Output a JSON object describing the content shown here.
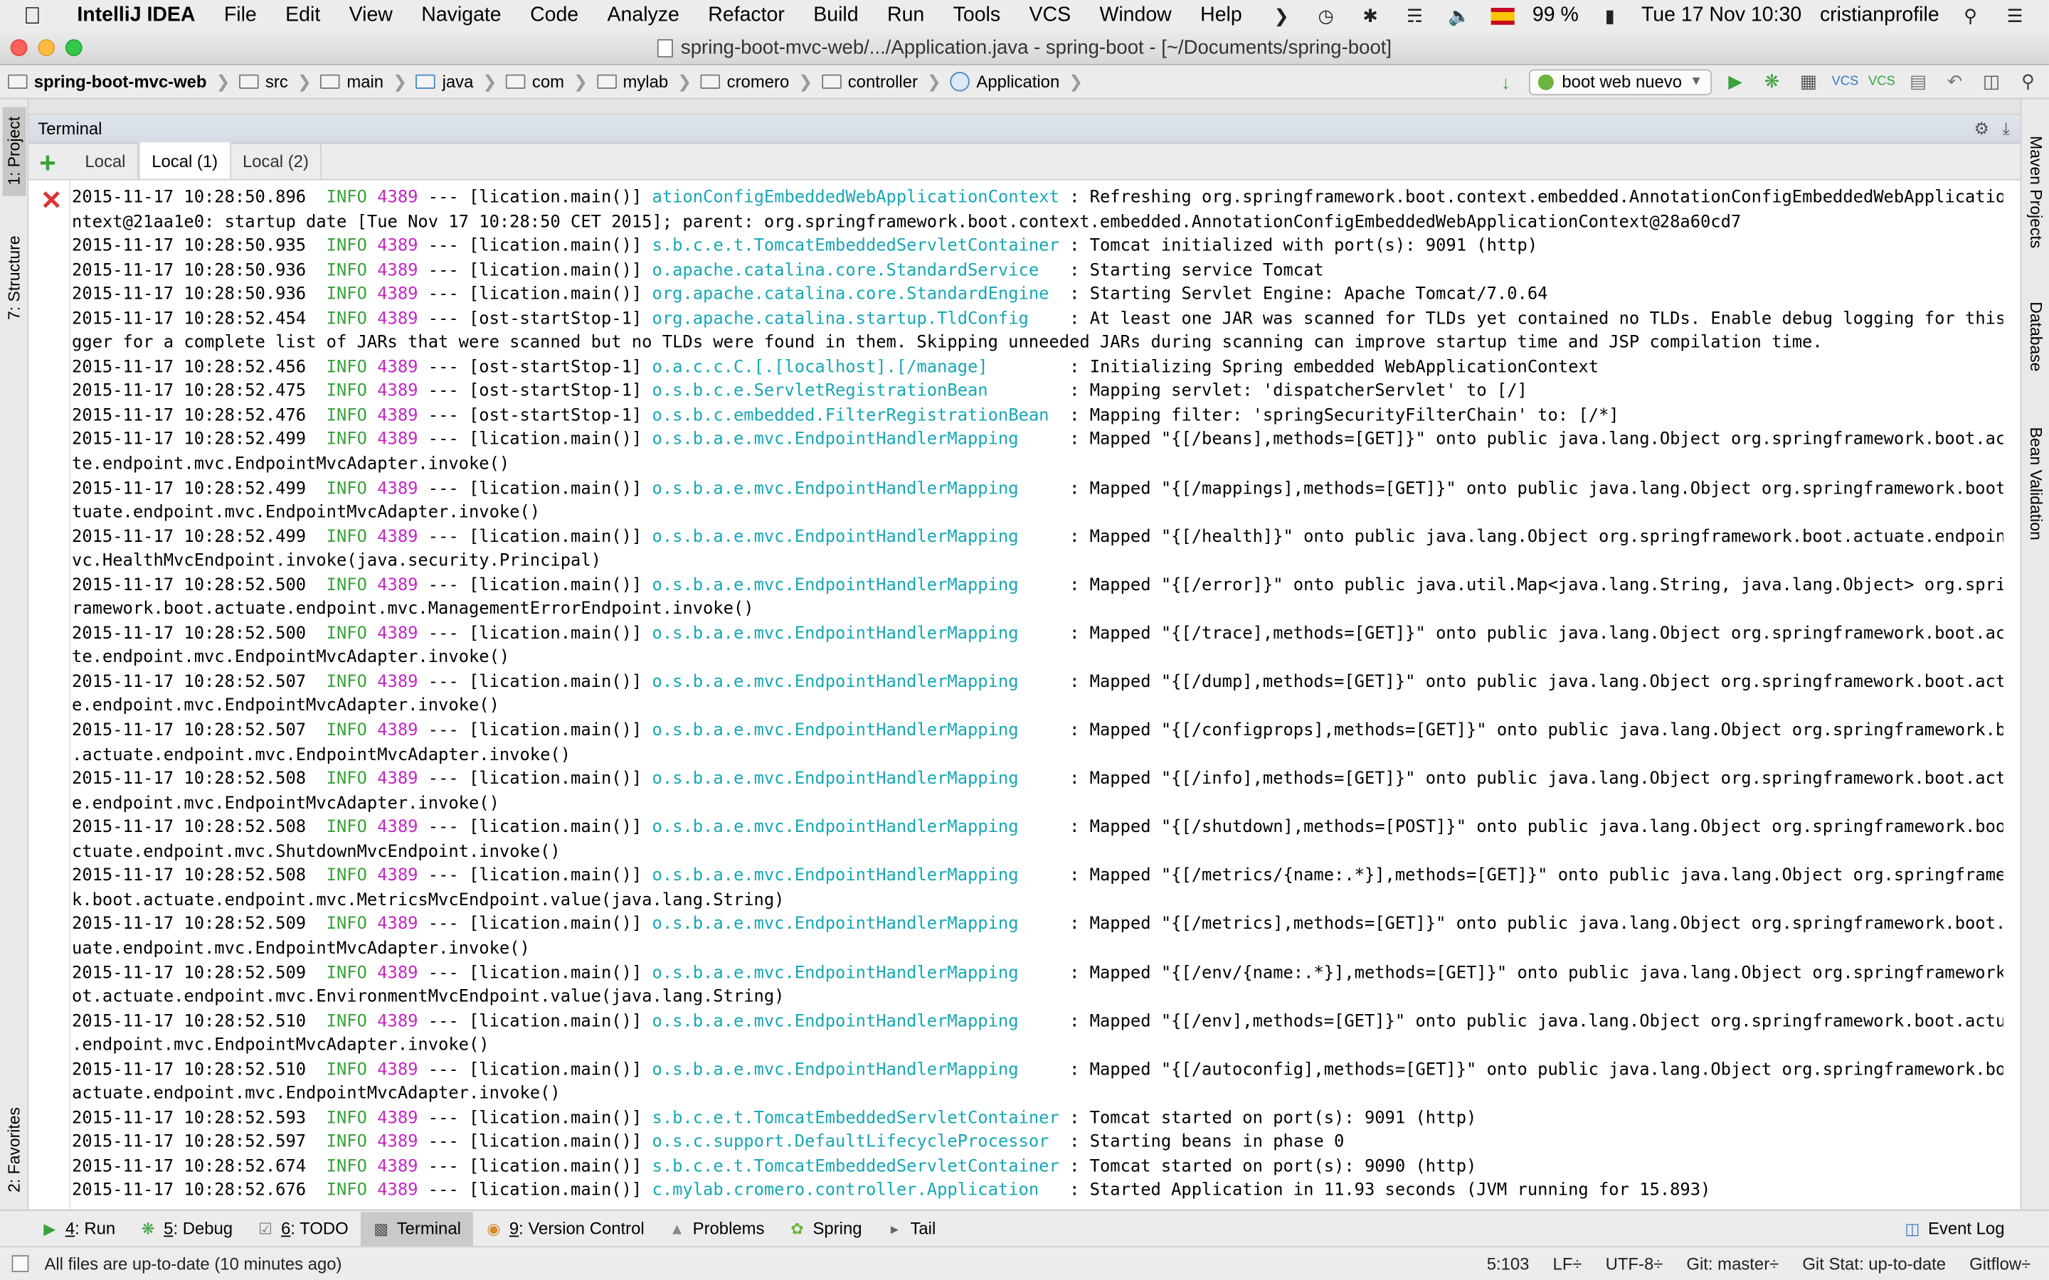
{
  "menubar": {
    "app_name": "IntelliJ IDEA",
    "items": [
      "File",
      "Edit",
      "View",
      "Navigate",
      "Code",
      "Analyze",
      "Refactor",
      "Build",
      "Run",
      "Tools",
      "VCS",
      "Window",
      "Help"
    ],
    "battery": "99 %",
    "datetime": "Tue 17 Nov  10:30",
    "user": "cristianprofile"
  },
  "window": {
    "title": "spring-boot-mvc-web/.../Application.java - spring-boot - [~/Documents/spring-boot]"
  },
  "navbar": {
    "crumbs": [
      "spring-boot-mvc-web",
      "src",
      "main",
      "java",
      "com",
      "mylab",
      "cromero",
      "controller",
      "Application"
    ],
    "run_config": "boot web nuevo"
  },
  "left_stripe": {
    "project": "1: Project",
    "structure": "7: Structure",
    "favorites": "2: Favorites"
  },
  "right_stripe": {
    "maven": "Maven Projects",
    "database": "Database",
    "bean": "Bean Validation"
  },
  "terminal": {
    "title": "Terminal",
    "tabs": [
      "Local",
      "Local (1)",
      "Local (2)"
    ],
    "selected_tab": "Local (1)",
    "lines": [
      {
        "ts": "2015-11-17 10:28:50.896",
        "level": "INFO",
        "pid": "4389",
        "thread": " --- [lication.main()] ",
        "cls": "ationConfigEmbeddedWebApplicationContext",
        "pad": " ",
        "msg": ": Refreshing org.springframework.boot.context.embedded.AnnotationConfigEmbeddedWebApplicationCo"
      },
      {
        "cont": "ntext@21aa1e0: startup date [Tue Nov 17 10:28:50 CET 2015]; parent: org.springframework.boot.context.embedded.AnnotationConfigEmbeddedWebApplicationContext@28a60cd7"
      },
      {
        "ts": "2015-11-17 10:28:50.935",
        "level": "INFO",
        "pid": "4389",
        "thread": " --- [lication.main()] ",
        "cls": "s.b.c.e.t.TomcatEmbeddedServletContainer",
        "pad": " ",
        "msg": ": Tomcat initialized with port(s): 9091 (http)"
      },
      {
        "ts": "2015-11-17 10:28:50.936",
        "level": "INFO",
        "pid": "4389",
        "thread": " --- [lication.main()] ",
        "cls": "o.apache.catalina.core.StandardService",
        "pad": "   ",
        "msg": ": Starting service Tomcat"
      },
      {
        "ts": "2015-11-17 10:28:50.936",
        "level": "INFO",
        "pid": "4389",
        "thread": " --- [lication.main()] ",
        "cls": "org.apache.catalina.core.StandardEngine",
        "pad": "  ",
        "msg": ": Starting Servlet Engine: Apache Tomcat/7.0.64"
      },
      {
        "ts": "2015-11-17 10:28:52.454",
        "level": "INFO",
        "pid": "4389",
        "thread": " --- [ost-startStop-1] ",
        "cls": "org.apache.catalina.startup.TldConfig",
        "pad": "    ",
        "msg": ": At least one JAR was scanned for TLDs yet contained no TLDs. Enable debug logging for this lo"
      },
      {
        "cont": "gger for a complete list of JARs that were scanned but no TLDs were found in them. Skipping unneeded JARs during scanning can improve startup time and JSP compilation time."
      },
      {
        "ts": "2015-11-17 10:28:52.456",
        "level": "INFO",
        "pid": "4389",
        "thread": " --- [ost-startStop-1] ",
        "cls": "o.a.c.c.C.[.[localhost].[/manage]",
        "pad": "        ",
        "msg": ": Initializing Spring embedded WebApplicationContext"
      },
      {
        "ts": "2015-11-17 10:28:52.475",
        "level": "INFO",
        "pid": "4389",
        "thread": " --- [ost-startStop-1] ",
        "cls": "o.s.b.c.e.ServletRegistrationBean",
        "pad": "        ",
        "msg": ": Mapping servlet: 'dispatcherServlet' to [/]"
      },
      {
        "ts": "2015-11-17 10:28:52.476",
        "level": "INFO",
        "pid": "4389",
        "thread": " --- [ost-startStop-1] ",
        "cls": "o.s.b.c.embedded.FilterRegistrationBean",
        "pad": "  ",
        "msg": ": Mapping filter: 'springSecurityFilterChain' to: [/*]"
      },
      {
        "ts": "2015-11-17 10:28:52.499",
        "level": "INFO",
        "pid": "4389",
        "thread": " --- [lication.main()] ",
        "cls": "o.s.b.a.e.mvc.EndpointHandlerMapping",
        "pad": "     ",
        "msg": ": Mapped \"{[/beans],methods=[GET]}\" onto public java.lang.Object org.springframework.boot.actua"
      },
      {
        "cont": "te.endpoint.mvc.EndpointMvcAdapter.invoke()"
      },
      {
        "ts": "2015-11-17 10:28:52.499",
        "level": "INFO",
        "pid": "4389",
        "thread": " --- [lication.main()] ",
        "cls": "o.s.b.a.e.mvc.EndpointHandlerMapping",
        "pad": "     ",
        "msg": ": Mapped \"{[/mappings],methods=[GET]}\" onto public java.lang.Object org.springframework.boot.ac"
      },
      {
        "cont": "tuate.endpoint.mvc.EndpointMvcAdapter.invoke()"
      },
      {
        "ts": "2015-11-17 10:28:52.499",
        "level": "INFO",
        "pid": "4389",
        "thread": " --- [lication.main()] ",
        "cls": "o.s.b.a.e.mvc.EndpointHandlerMapping",
        "pad": "     ",
        "msg": ": Mapped \"{[/health]}\" onto public java.lang.Object org.springframework.boot.actuate.endpoint.m"
      },
      {
        "cont": "vc.HealthMvcEndpoint.invoke(java.security.Principal)"
      },
      {
        "ts": "2015-11-17 10:28:52.500",
        "level": "INFO",
        "pid": "4389",
        "thread": " --- [lication.main()] ",
        "cls": "o.s.b.a.e.mvc.EndpointHandlerMapping",
        "pad": "     ",
        "msg": ": Mapped \"{[/error]}\" onto public java.util.Map<java.lang.String, java.lang.Object> org.springf"
      },
      {
        "cont": "ramework.boot.actuate.endpoint.mvc.ManagementErrorEndpoint.invoke()"
      },
      {
        "ts": "2015-11-17 10:28:52.500",
        "level": "INFO",
        "pid": "4389",
        "thread": " --- [lication.main()] ",
        "cls": "o.s.b.a.e.mvc.EndpointHandlerMapping",
        "pad": "     ",
        "msg": ": Mapped \"{[/trace],methods=[GET]}\" onto public java.lang.Object org.springframework.boot.actua"
      },
      {
        "cont": "te.endpoint.mvc.EndpointMvcAdapter.invoke()"
      },
      {
        "ts": "2015-11-17 10:28:52.507",
        "level": "INFO",
        "pid": "4389",
        "thread": " --- [lication.main()] ",
        "cls": "o.s.b.a.e.mvc.EndpointHandlerMapping",
        "pad": "     ",
        "msg": ": Mapped \"{[/dump],methods=[GET]}\" onto public java.lang.Object org.springframework.boot.actuat"
      },
      {
        "cont": "e.endpoint.mvc.EndpointMvcAdapter.invoke()"
      },
      {
        "ts": "2015-11-17 10:28:52.507",
        "level": "INFO",
        "pid": "4389",
        "thread": " --- [lication.main()] ",
        "cls": "o.s.b.a.e.mvc.EndpointHandlerMapping",
        "pad": "     ",
        "msg": ": Mapped \"{[/configprops],methods=[GET]}\" onto public java.lang.Object org.springframework.boot"
      },
      {
        "cont": ".actuate.endpoint.mvc.EndpointMvcAdapter.invoke()"
      },
      {
        "ts": "2015-11-17 10:28:52.508",
        "level": "INFO",
        "pid": "4389",
        "thread": " --- [lication.main()] ",
        "cls": "o.s.b.a.e.mvc.EndpointHandlerMapping",
        "pad": "     ",
        "msg": ": Mapped \"{[/info],methods=[GET]}\" onto public java.lang.Object org.springframework.boot.actuat"
      },
      {
        "cont": "e.endpoint.mvc.EndpointMvcAdapter.invoke()"
      },
      {
        "ts": "2015-11-17 10:28:52.508",
        "level": "INFO",
        "pid": "4389",
        "thread": " --- [lication.main()] ",
        "cls": "o.s.b.a.e.mvc.EndpointHandlerMapping",
        "pad": "     ",
        "msg": ": Mapped \"{[/shutdown],methods=[POST]}\" onto public java.lang.Object org.springframework.boot.a"
      },
      {
        "cont": "ctuate.endpoint.mvc.ShutdownMvcEndpoint.invoke()"
      },
      {
        "ts": "2015-11-17 10:28:52.508",
        "level": "INFO",
        "pid": "4389",
        "thread": " --- [lication.main()] ",
        "cls": "o.s.b.a.e.mvc.EndpointHandlerMapping",
        "pad": "     ",
        "msg": ": Mapped \"{[/metrics/{name:.*}],methods=[GET]}\" onto public java.lang.Object org.springframewor"
      },
      {
        "cont": "k.boot.actuate.endpoint.mvc.MetricsMvcEndpoint.value(java.lang.String)"
      },
      {
        "ts": "2015-11-17 10:28:52.509",
        "level": "INFO",
        "pid": "4389",
        "thread": " --- [lication.main()] ",
        "cls": "o.s.b.a.e.mvc.EndpointHandlerMapping",
        "pad": "     ",
        "msg": ": Mapped \"{[/metrics],methods=[GET]}\" onto public java.lang.Object org.springframework.boot.act"
      },
      {
        "cont": "uate.endpoint.mvc.EndpointMvcAdapter.invoke()"
      },
      {
        "ts": "2015-11-17 10:28:52.509",
        "level": "INFO",
        "pid": "4389",
        "thread": " --- [lication.main()] ",
        "cls": "o.s.b.a.e.mvc.EndpointHandlerMapping",
        "pad": "     ",
        "msg": ": Mapped \"{[/env/{name:.*}],methods=[GET]}\" onto public java.lang.Object org.springframework.bo"
      },
      {
        "cont": "ot.actuate.endpoint.mvc.EnvironmentMvcEndpoint.value(java.lang.String)"
      },
      {
        "ts": "2015-11-17 10:28:52.510",
        "level": "INFO",
        "pid": "4389",
        "thread": " --- [lication.main()] ",
        "cls": "o.s.b.a.e.mvc.EndpointHandlerMapping",
        "pad": "     ",
        "msg": ": Mapped \"{[/env],methods=[GET]}\" onto public java.lang.Object org.springframework.boot.actuate"
      },
      {
        "cont": ".endpoint.mvc.EndpointMvcAdapter.invoke()"
      },
      {
        "ts": "2015-11-17 10:28:52.510",
        "level": "INFO",
        "pid": "4389",
        "thread": " --- [lication.main()] ",
        "cls": "o.s.b.a.e.mvc.EndpointHandlerMapping",
        "pad": "     ",
        "msg": ": Mapped \"{[/autoconfig],methods=[GET]}\" onto public java.lang.Object org.springframework.boot."
      },
      {
        "cont": "actuate.endpoint.mvc.EndpointMvcAdapter.invoke()"
      },
      {
        "ts": "2015-11-17 10:28:52.593",
        "level": "INFO",
        "pid": "4389",
        "thread": " --- [lication.main()] ",
        "cls": "s.b.c.e.t.TomcatEmbeddedServletContainer",
        "pad": " ",
        "msg": ": Tomcat started on port(s): 9091 (http)"
      },
      {
        "ts": "2015-11-17 10:28:52.597",
        "level": "INFO",
        "pid": "4389",
        "thread": " --- [lication.main()] ",
        "cls": "o.s.c.support.DefaultLifecycleProcessor",
        "pad": "  ",
        "msg": ": Starting beans in phase 0"
      },
      {
        "ts": "2015-11-17 10:28:52.674",
        "level": "INFO",
        "pid": "4389",
        "thread": " --- [lication.main()] ",
        "cls": "s.b.c.e.t.TomcatEmbeddedServletContainer",
        "pad": " ",
        "msg": ": Tomcat started on port(s): 9090 (http)"
      },
      {
        "ts": "2015-11-17 10:28:52.676",
        "level": "INFO",
        "pid": "4389",
        "thread": " --- [lication.main()] ",
        "cls": "c.mylab.cromero.controller.Application",
        "pad": "   ",
        "msg": ": Started Application in 11.93 seconds (JVM running for 15.893)"
      }
    ]
  },
  "bottom_tools": [
    {
      "key": "4",
      "label": ": Run",
      "icon": "run-icon"
    },
    {
      "key": "5",
      "label": ": Debug",
      "icon": "debug-icon"
    },
    {
      "key": "6",
      "label": ": TODO",
      "icon": "todo-icon"
    },
    {
      "key": "",
      "label": "Terminal",
      "icon": "terminal-icon"
    },
    {
      "key": "9",
      "label": ": Version Control",
      "icon": "vcs-icon"
    },
    {
      "key": "",
      "label": "Problems",
      "icon": "problems-icon"
    },
    {
      "key": "",
      "label": "Spring",
      "icon": "spring-icon"
    },
    {
      "key": "",
      "label": "Tail",
      "icon": "tail-icon"
    }
  ],
  "event_log": "Event Log",
  "status": {
    "message": "All files are up-to-date (10 minutes ago)",
    "position": "5:103",
    "line_sep": "LF÷",
    "encoding": "UTF-8÷",
    "git": "Git: master÷",
    "git_stat": "Git Stat: up-to-date",
    "gitflow": "Gitflow÷"
  },
  "colors": {
    "info": "#3aa23a",
    "pid": "#c327c3",
    "class": "#17a7b5"
  }
}
